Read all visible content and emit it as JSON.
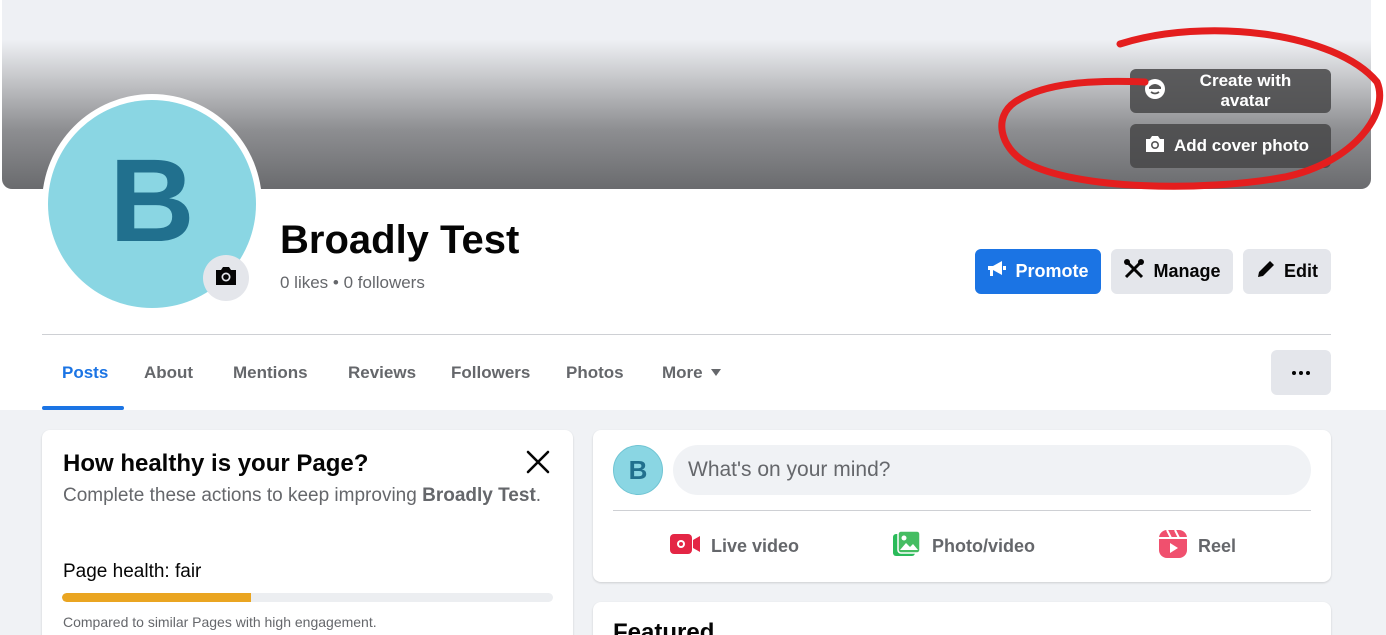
{
  "cover": {
    "create_avatar_label": "Create with avatar",
    "add_cover_label": "Add cover photo"
  },
  "profile": {
    "avatar_letter": "B",
    "name": "Broadly Test",
    "stats": "0 likes • 0 followers"
  },
  "actions": {
    "promote": "Promote",
    "manage": "Manage",
    "edit": "Edit"
  },
  "tabs": [
    {
      "label": "Posts",
      "active": true
    },
    {
      "label": "About"
    },
    {
      "label": "Mentions"
    },
    {
      "label": "Reviews"
    },
    {
      "label": "Followers"
    },
    {
      "label": "Photos"
    },
    {
      "label": "More"
    }
  ],
  "health": {
    "title": "How healthy is your Page?",
    "desc_prefix": "Complete these actions to keep improving ",
    "desc_name": "Broadly Test",
    "desc_suffix": ".",
    "status": "Page health: fair",
    "progress": 0.385,
    "note": "Compared to similar Pages with high engagement."
  },
  "composer": {
    "avatar_letter": "B",
    "placeholder": "What's on your mind?",
    "live_video": "Live video",
    "photo_video": "Photo/video",
    "reel": "Reel"
  },
  "featured": {
    "title": "Featured"
  },
  "colors": {
    "accent": "#1b74e4",
    "annotation": "#e41e1e",
    "health_fill": "#eaa521"
  }
}
